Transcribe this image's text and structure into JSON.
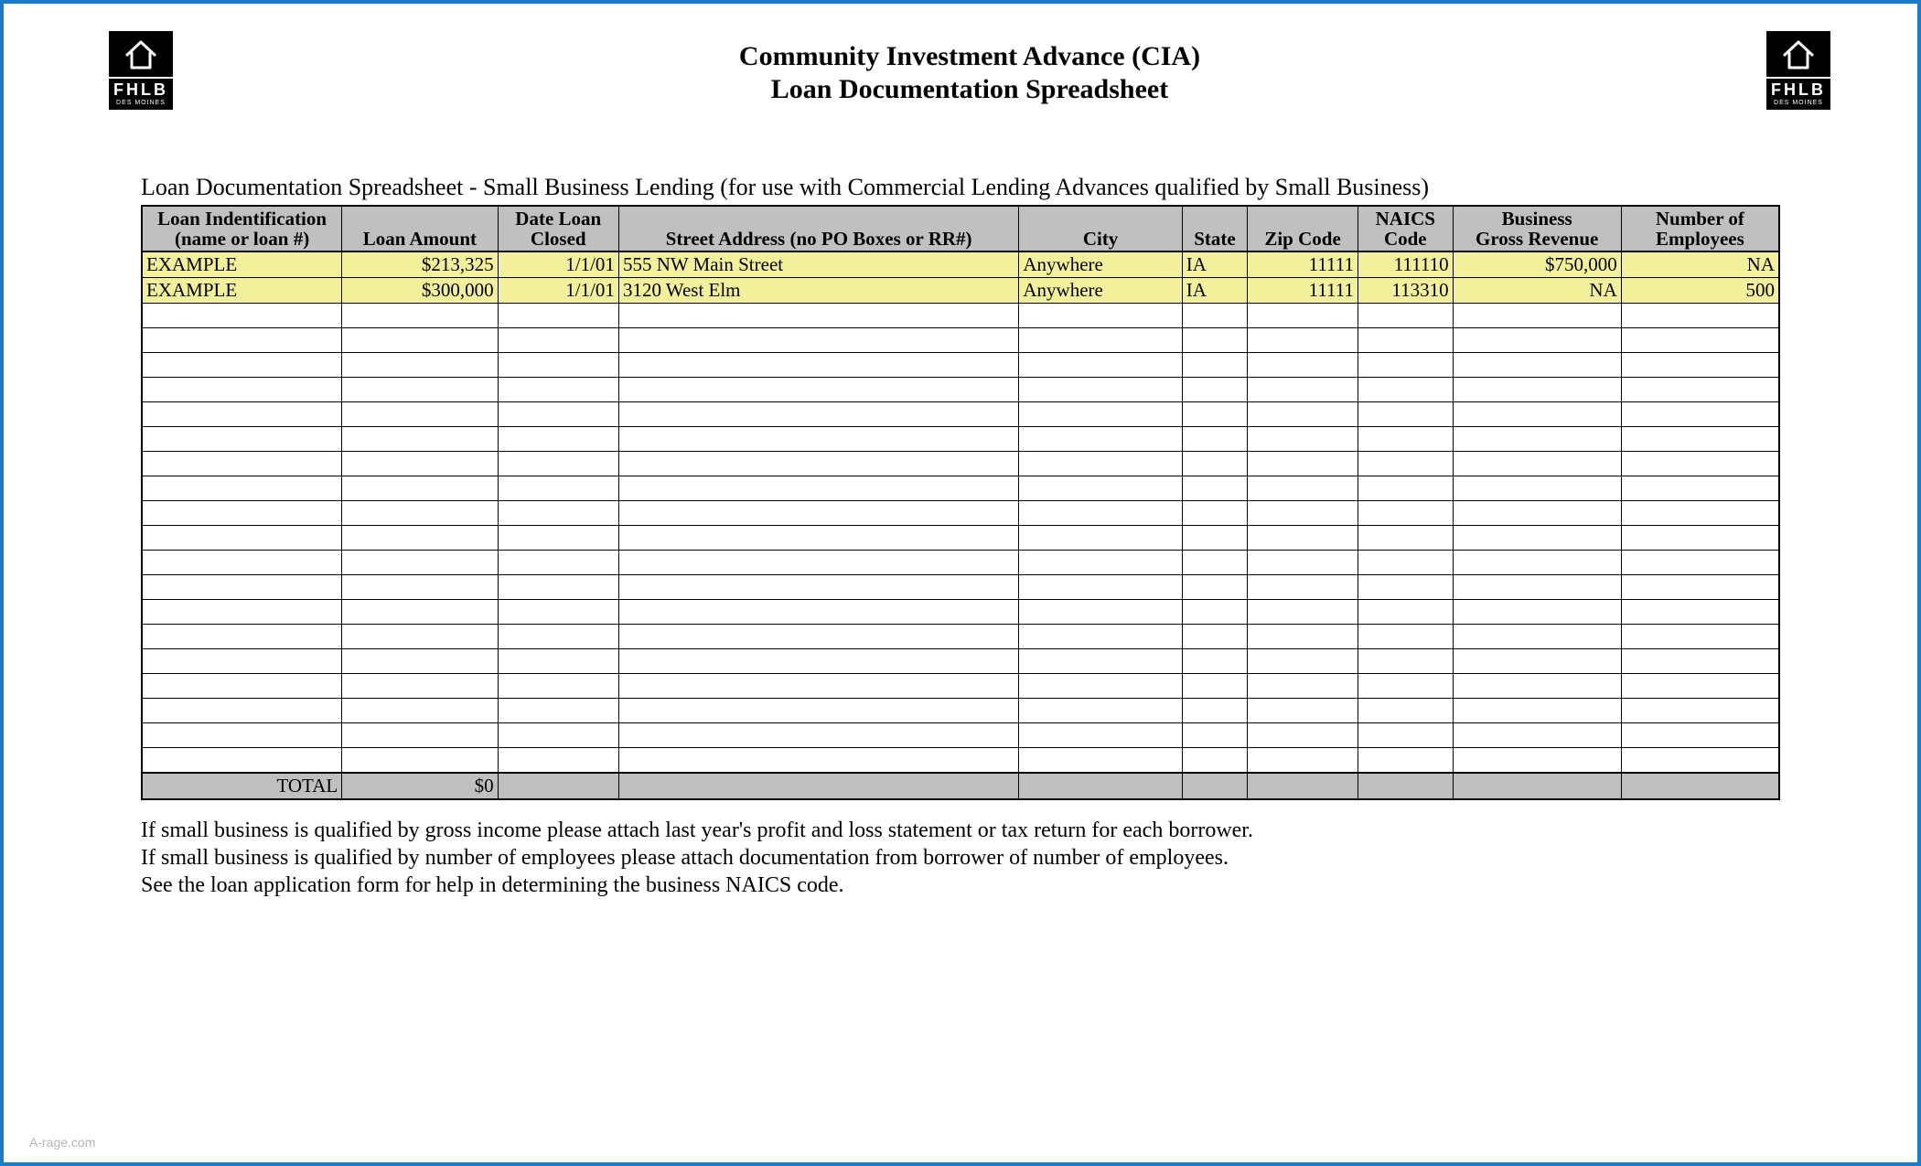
{
  "logo": {
    "name": "FHLB",
    "sub": "DES MOINES"
  },
  "title": {
    "line1": "Community Investment Advance (CIA)",
    "line2": "Loan Documentation Spreadsheet"
  },
  "sheet_title": "Loan Documentation Spreadsheet - Small Business Lending (for use with Commercial Lending Advances qualified by Small Business)",
  "columns": [
    {
      "key": "loan_id",
      "header": "Loan Indentification (name or loan #)"
    },
    {
      "key": "amount",
      "header": "Loan Amount"
    },
    {
      "key": "date_closed",
      "header": "Date Loan Closed"
    },
    {
      "key": "address",
      "header": "Street Address (no PO Boxes or RR#)"
    },
    {
      "key": "city",
      "header": "City"
    },
    {
      "key": "state",
      "header": "State"
    },
    {
      "key": "zip",
      "header": "Zip Code"
    },
    {
      "key": "naics",
      "header": "NAICS Code"
    },
    {
      "key": "revenue",
      "header": "Business Gross Revenue"
    },
    {
      "key": "employees",
      "header": "Number of Employees"
    }
  ],
  "example_rows": [
    {
      "loan_id": "EXAMPLE",
      "amount": "$213,325",
      "date_closed": "1/1/01",
      "address": "555 NW Main Street",
      "city": "Anywhere",
      "state": "IA",
      "zip": "11111",
      "naics": "111110",
      "revenue": "$750,000",
      "employees": "NA"
    },
    {
      "loan_id": "EXAMPLE",
      "amount": "$300,000",
      "date_closed": "1/1/01",
      "address": "3120 West Elm",
      "city": "Anywhere",
      "state": "IA",
      "zip": "11111",
      "naics": "113310",
      "revenue": "NA",
      "employees": "500"
    }
  ],
  "blank_row_count": 19,
  "total": {
    "label": "TOTAL",
    "amount": "$0"
  },
  "footer_notes": [
    "If small business is qualified by gross income please attach last year's profit and loss statement or tax return for each borrower.",
    "If small business is qualified by number of employees please attach documentation from borrower of number of employees.",
    "See the loan application form for help in determining the business NAICS code."
  ],
  "watermark": "A-rage.com"
}
